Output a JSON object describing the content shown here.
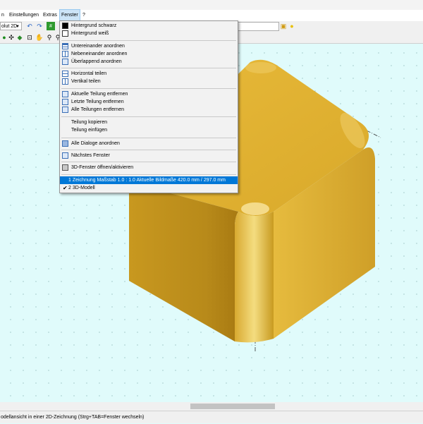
{
  "menubar": {
    "items": [
      "n",
      "Einstellungen",
      "Extras",
      "Fenster",
      "?"
    ],
    "active_index": 3
  },
  "toolbar": {
    "combo_value": "olut 2D"
  },
  "fenster_menu": {
    "items": [
      {
        "label": "Hintergrund schwarz",
        "icon": "black-square-icon"
      },
      {
        "label": "Hintergrund weiß",
        "icon": "white-square-icon"
      },
      {
        "label": "Untereinander anordnen",
        "icon": "tile-horizontal-icon"
      },
      {
        "label": "Nebeneinander anordnen",
        "icon": "tile-vertical-icon"
      },
      {
        "label": "Überlappend anordnen",
        "icon": "cascade-icon"
      },
      {
        "label": "Horizontal teilen",
        "icon": "split-horizontal-icon"
      },
      {
        "label": "Vertikal teilen",
        "icon": "split-vertical-icon"
      },
      {
        "label": "Aktuelle Teilung entfernen",
        "icon": "remove-current-split-icon"
      },
      {
        "label": "Letzte Teilung entfernen",
        "icon": "remove-last-split-icon"
      },
      {
        "label": "Alle Teilungen entfernen",
        "icon": "remove-all-splits-icon"
      },
      {
        "label": "Teilung kopieren",
        "icon": ""
      },
      {
        "label": "Teilung einfügen",
        "icon": ""
      },
      {
        "label": "Alle Dialoge anordnen",
        "icon": "dialogs-icon"
      },
      {
        "label": "Nächstes Fenster",
        "icon": "next-window-icon"
      },
      {
        "label": "3D-Fenster öffnen/aktivieren",
        "icon": "3d-window-icon"
      }
    ],
    "window_list": [
      {
        "label": "1 Zeichnung     Maßstab 1.0 : 1.0     Aktuelle Bildmaße 420.0 mm / 297.0 mm",
        "selected": true,
        "checked": false
      },
      {
        "label": "2 3D-Modell",
        "selected": false,
        "checked": true
      }
    ]
  },
  "statusbar": {
    "text": "odellansicht in einer 2D-Zeichnung (Strg+TAB=Fenster wechseln)"
  },
  "colors": {
    "canvas_bg": "#e0fbfb",
    "cube_top": "#e9bc3c",
    "cube_left": "#b88a1e",
    "cube_right": "#dcb036",
    "highlight": "#0078d7"
  }
}
